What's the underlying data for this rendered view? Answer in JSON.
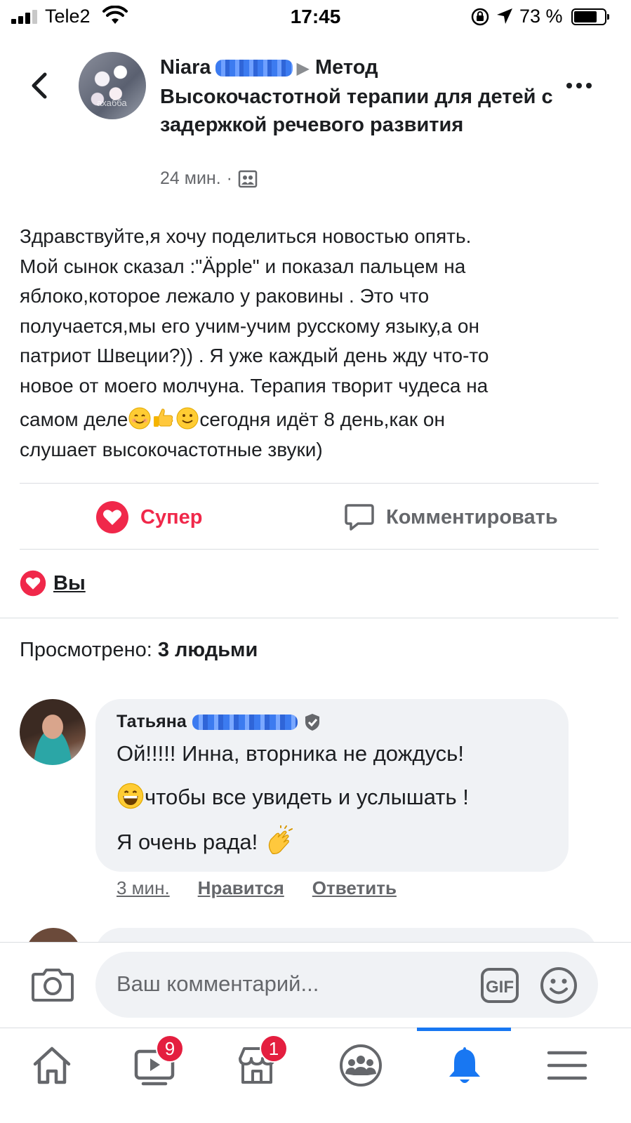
{
  "status_bar": {
    "carrier": "Tele2",
    "time": "17:45",
    "battery_text": "73 %",
    "battery_level": 0.73
  },
  "post": {
    "author": "Niara",
    "group": "Метод Высокочастотной терапии для детей с задержкой речевого развития",
    "time": "24 мин.",
    "separator": "·",
    "avatar_watermark": "ахабба",
    "body_lines": [
      "Здравствуйте,я хочу поделиться новостью опять.",
      "Мой сынок сказал :\"Äpple\" и показал пальцем на",
      "яблоко,которое лежало у раковины .  Это что",
      "получается,мы его учим-учим русскому языку,а он",
      "патриот Швеции?)) . Я уже каждый день жду что-то",
      "новое от моего молчуна. Терапия творит чудеса на"
    ],
    "body_line7_a": "самом деле",
    "body_line7_b": "сегодня идёт 8 день,как он",
    "body_line8": "слушает высокочастотные звуки)",
    "emoji_names": [
      "smiling-face-icon",
      "thumbs-up-icon",
      "slight-smile-icon"
    ]
  },
  "actions": {
    "super_label": "Супер",
    "comment_label": "Комментировать"
  },
  "reactions": {
    "label": "Вы"
  },
  "viewed": {
    "prefix": "Просмотрено: ",
    "count": "3 людьми"
  },
  "comment": {
    "author": "Татьяна",
    "line1": "Ой!!!!! Инна, вторника не дождусь!",
    "line2": "чтобы все увидеть и услышать !",
    "line3": "Я очень рада!",
    "time": "3 мин.",
    "like_label": "Нравится",
    "reply_label": "Ответить"
  },
  "composer": {
    "placeholder": "Ваш комментарий...",
    "gif_label": "GIF"
  },
  "tabbar": {
    "items": [
      {
        "name": "home",
        "icon": "home-icon",
        "badge": ""
      },
      {
        "name": "watch",
        "icon": "video-icon",
        "badge": "9"
      },
      {
        "name": "marketplace",
        "icon": "shop-icon",
        "badge": "1"
      },
      {
        "name": "groups",
        "icon": "groups-icon",
        "badge": ""
      },
      {
        "name": "notifications",
        "icon": "bell-icon",
        "badge": "",
        "active": true
      },
      {
        "name": "menu",
        "icon": "menu-icon",
        "badge": ""
      }
    ]
  },
  "colors": {
    "accent": "#1877f2",
    "love": "#f0284a",
    "badge": "#e41e3f",
    "bubble": "#f0f2f5",
    "secondary_text": "#65676b"
  }
}
